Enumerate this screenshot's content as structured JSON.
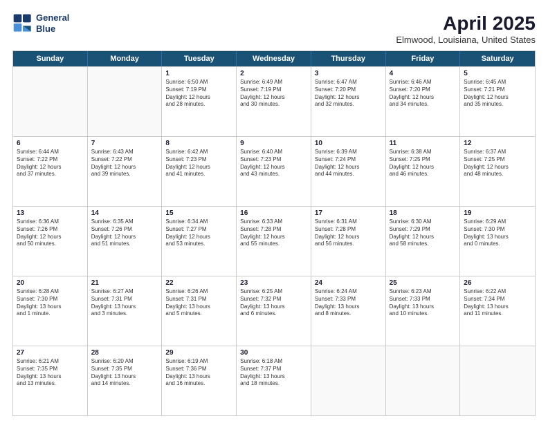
{
  "header": {
    "logo_line1": "General",
    "logo_line2": "Blue",
    "main_title": "April 2025",
    "subtitle": "Elmwood, Louisiana, United States"
  },
  "days_of_week": [
    "Sunday",
    "Monday",
    "Tuesday",
    "Wednesday",
    "Thursday",
    "Friday",
    "Saturday"
  ],
  "weeks": [
    [
      {
        "day": "",
        "info": ""
      },
      {
        "day": "",
        "info": ""
      },
      {
        "day": "1",
        "info": "Sunrise: 6:50 AM\nSunset: 7:19 PM\nDaylight: 12 hours\nand 28 minutes."
      },
      {
        "day": "2",
        "info": "Sunrise: 6:49 AM\nSunset: 7:19 PM\nDaylight: 12 hours\nand 30 minutes."
      },
      {
        "day": "3",
        "info": "Sunrise: 6:47 AM\nSunset: 7:20 PM\nDaylight: 12 hours\nand 32 minutes."
      },
      {
        "day": "4",
        "info": "Sunrise: 6:46 AM\nSunset: 7:20 PM\nDaylight: 12 hours\nand 34 minutes."
      },
      {
        "day": "5",
        "info": "Sunrise: 6:45 AM\nSunset: 7:21 PM\nDaylight: 12 hours\nand 35 minutes."
      }
    ],
    [
      {
        "day": "6",
        "info": "Sunrise: 6:44 AM\nSunset: 7:22 PM\nDaylight: 12 hours\nand 37 minutes."
      },
      {
        "day": "7",
        "info": "Sunrise: 6:43 AM\nSunset: 7:22 PM\nDaylight: 12 hours\nand 39 minutes."
      },
      {
        "day": "8",
        "info": "Sunrise: 6:42 AM\nSunset: 7:23 PM\nDaylight: 12 hours\nand 41 minutes."
      },
      {
        "day": "9",
        "info": "Sunrise: 6:40 AM\nSunset: 7:23 PM\nDaylight: 12 hours\nand 43 minutes."
      },
      {
        "day": "10",
        "info": "Sunrise: 6:39 AM\nSunset: 7:24 PM\nDaylight: 12 hours\nand 44 minutes."
      },
      {
        "day": "11",
        "info": "Sunrise: 6:38 AM\nSunset: 7:25 PM\nDaylight: 12 hours\nand 46 minutes."
      },
      {
        "day": "12",
        "info": "Sunrise: 6:37 AM\nSunset: 7:25 PM\nDaylight: 12 hours\nand 48 minutes."
      }
    ],
    [
      {
        "day": "13",
        "info": "Sunrise: 6:36 AM\nSunset: 7:26 PM\nDaylight: 12 hours\nand 50 minutes."
      },
      {
        "day": "14",
        "info": "Sunrise: 6:35 AM\nSunset: 7:26 PM\nDaylight: 12 hours\nand 51 minutes."
      },
      {
        "day": "15",
        "info": "Sunrise: 6:34 AM\nSunset: 7:27 PM\nDaylight: 12 hours\nand 53 minutes."
      },
      {
        "day": "16",
        "info": "Sunrise: 6:33 AM\nSunset: 7:28 PM\nDaylight: 12 hours\nand 55 minutes."
      },
      {
        "day": "17",
        "info": "Sunrise: 6:31 AM\nSunset: 7:28 PM\nDaylight: 12 hours\nand 56 minutes."
      },
      {
        "day": "18",
        "info": "Sunrise: 6:30 AM\nSunset: 7:29 PM\nDaylight: 12 hours\nand 58 minutes."
      },
      {
        "day": "19",
        "info": "Sunrise: 6:29 AM\nSunset: 7:30 PM\nDaylight: 13 hours\nand 0 minutes."
      }
    ],
    [
      {
        "day": "20",
        "info": "Sunrise: 6:28 AM\nSunset: 7:30 PM\nDaylight: 13 hours\nand 1 minute."
      },
      {
        "day": "21",
        "info": "Sunrise: 6:27 AM\nSunset: 7:31 PM\nDaylight: 13 hours\nand 3 minutes."
      },
      {
        "day": "22",
        "info": "Sunrise: 6:26 AM\nSunset: 7:31 PM\nDaylight: 13 hours\nand 5 minutes."
      },
      {
        "day": "23",
        "info": "Sunrise: 6:25 AM\nSunset: 7:32 PM\nDaylight: 13 hours\nand 6 minutes."
      },
      {
        "day": "24",
        "info": "Sunrise: 6:24 AM\nSunset: 7:33 PM\nDaylight: 13 hours\nand 8 minutes."
      },
      {
        "day": "25",
        "info": "Sunrise: 6:23 AM\nSunset: 7:33 PM\nDaylight: 13 hours\nand 10 minutes."
      },
      {
        "day": "26",
        "info": "Sunrise: 6:22 AM\nSunset: 7:34 PM\nDaylight: 13 hours\nand 11 minutes."
      }
    ],
    [
      {
        "day": "27",
        "info": "Sunrise: 6:21 AM\nSunset: 7:35 PM\nDaylight: 13 hours\nand 13 minutes."
      },
      {
        "day": "28",
        "info": "Sunrise: 6:20 AM\nSunset: 7:35 PM\nDaylight: 13 hours\nand 14 minutes."
      },
      {
        "day": "29",
        "info": "Sunrise: 6:19 AM\nSunset: 7:36 PM\nDaylight: 13 hours\nand 16 minutes."
      },
      {
        "day": "30",
        "info": "Sunrise: 6:18 AM\nSunset: 7:37 PM\nDaylight: 13 hours\nand 18 minutes."
      },
      {
        "day": "",
        "info": ""
      },
      {
        "day": "",
        "info": ""
      },
      {
        "day": "",
        "info": ""
      }
    ]
  ]
}
